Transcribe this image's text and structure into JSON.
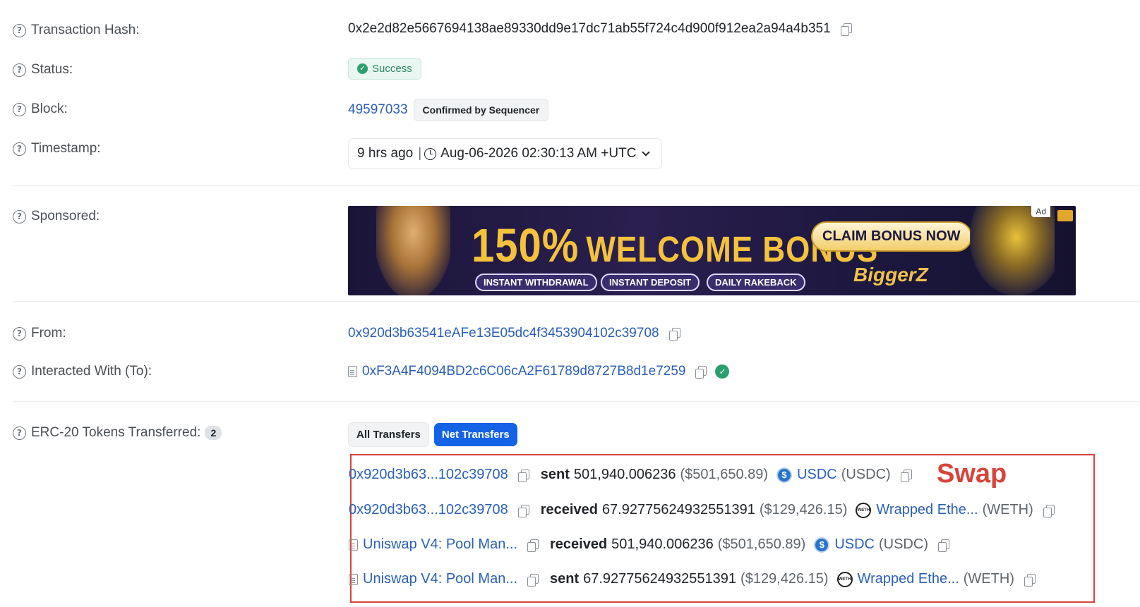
{
  "labels": {
    "tx_hash": "Transaction Hash:",
    "status": "Status:",
    "block": "Block:",
    "timestamp": "Timestamp:",
    "sponsored": "Sponsored:",
    "from": "From:",
    "to": "Interacted With (To):",
    "erc20": "ERC-20 Tokens Transferred:"
  },
  "tx_hash": "0x2e2d82e5667694138ae89330dd9e17dc71ab55f724c4d900f912ea2a94a4b351",
  "status": "Success",
  "block": {
    "number": "49597033",
    "confirmation": "Confirmed by Sequencer"
  },
  "timestamp": {
    "relative": "9 hrs ago",
    "separator": "|",
    "absolute": "Aug-06-2026 02:30:13 AM +UTC"
  },
  "ad": {
    "percent": "150%",
    "headline": "WELCOME BONUS",
    "cta": "CLAIM BONUS NOW",
    "pills": [
      "INSTANT WITHDRAWAL",
      "INSTANT DEPOSIT",
      "DAILY RAKEBACK"
    ],
    "brand": "BiggerZ",
    "tag": "Ad"
  },
  "from": "0x920d3b63541eAFe13E05dc4f3453904102c39708",
  "to": "0xF3A4F4094BD2c6C06cA2F61789d8727B8d1e7259",
  "erc20": {
    "count": "2",
    "tabs": [
      "All Transfers",
      "Net Transfers"
    ],
    "annotation": "Swap",
    "transfers": [
      {
        "party": "0x920d3b63...102c39708",
        "action": "sent",
        "amount": "501,940.006236",
        "usd": "($501,650.89)",
        "token": "USDC",
        "symbol": "(USDC)",
        "token_icon": "usdc-icon",
        "contract": false
      },
      {
        "party": "0x920d3b63...102c39708",
        "action": "received",
        "amount": "67.92775624932551391",
        "usd": "($129,426.15)",
        "token": "Wrapped Ethe...",
        "symbol": "(WETH)",
        "token_icon": "weth-icon",
        "contract": false
      },
      {
        "party": "Uniswap V4: Pool Man...",
        "action": "received",
        "amount": "501,940.006236",
        "usd": "($501,650.89)",
        "token": "USDC",
        "symbol": "(USDC)",
        "token_icon": "usdc-icon",
        "contract": true
      },
      {
        "party": "Uniswap V4: Pool Man...",
        "action": "sent",
        "amount": "67.92775624932551391",
        "usd": "($129,426.15)",
        "token": "Wrapped Ethe...",
        "symbol": "(WETH)",
        "token_icon": "weth-icon",
        "contract": true
      }
    ]
  }
}
